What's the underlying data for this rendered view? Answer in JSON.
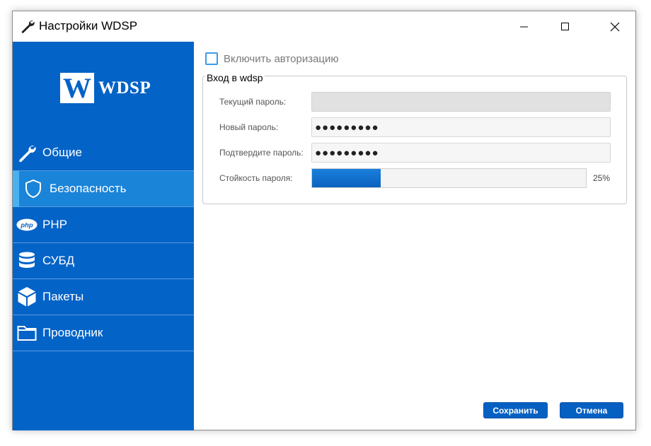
{
  "window": {
    "title": "Настройки WDSP"
  },
  "sidebar": {
    "logo_letter": "W",
    "logo_text": "WDSP",
    "items": [
      {
        "label": "Общие",
        "icon": "wrench-icon",
        "active": false
      },
      {
        "label": "Безопасность",
        "icon": "shield-icon",
        "active": true
      },
      {
        "label": "PHP",
        "icon": "php-icon",
        "active": false
      },
      {
        "label": "СУБД",
        "icon": "database-icon",
        "active": false
      },
      {
        "label": "Пакеты",
        "icon": "package-icon",
        "active": false
      },
      {
        "label": "Проводник",
        "icon": "folder-icon",
        "active": false
      }
    ]
  },
  "security": {
    "enable_auth_label": "Включить авторизацию",
    "enable_auth_checked": false,
    "group_title": "Вход в wdsp",
    "current_password_label": "Текущий пароль:",
    "current_password_value": "",
    "new_password_label": "Новый пароль:",
    "new_password_value": "●●●●●●●●●",
    "confirm_password_label": "Подтвердите пароль:",
    "confirm_password_value": "●●●●●●●●●",
    "strength_label": "Стойкость пароля:",
    "strength_value": 0.25,
    "strength_text": "25%"
  },
  "buttons": {
    "save": "Сохранить",
    "cancel": "Отмена"
  },
  "colors": {
    "sidebar": "#0463c7",
    "active_item": "#1a84d9",
    "accent": "#49b1f0",
    "button": "#0560c2"
  }
}
